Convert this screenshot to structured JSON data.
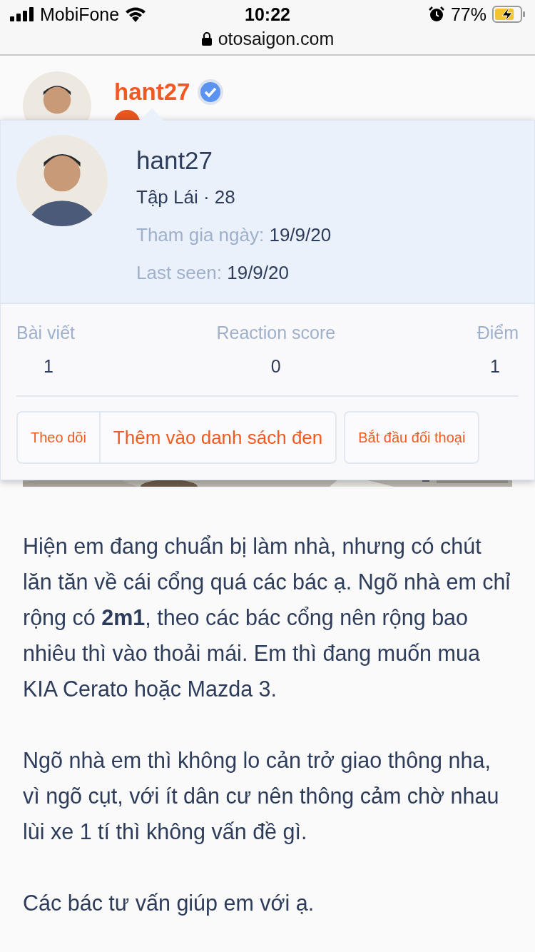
{
  "status_bar": {
    "carrier": "MobiFone",
    "time": "10:22",
    "battery": "77%",
    "charging": true,
    "alarm": true
  },
  "browser": {
    "url": "otosaigon.com",
    "secure": true
  },
  "post_author": {
    "name": "hant27",
    "verified": true
  },
  "profile_popup": {
    "name": "hant27",
    "rank": "Tập Lái · 28",
    "details": [
      {
        "label": "Tham gia ngày:",
        "value": "19/9/20"
      },
      {
        "label": "Last seen:",
        "value": "19/9/20"
      }
    ],
    "stats": [
      {
        "label": "Bài viết",
        "value": "1"
      },
      {
        "label": "Reaction score",
        "value": "0"
      },
      {
        "label": "Điểm",
        "value": "1"
      }
    ],
    "button_groups": [
      [
        {
          "label": "Theo dõi",
          "kind": "compact"
        },
        {
          "label": "Thêm vào danh sách đen",
          "kind": "wide"
        }
      ],
      [
        {
          "label": "Bắt đầu đối thoại",
          "kind": "compact"
        }
      ]
    ]
  },
  "post_body": {
    "paragraphs": [
      "Hiện em đang chuẩn bị làm nhà, nhưng có chút lăn tăn về cái cổng quá các bác ạ. Ngõ nhà em chỉ rộng có **2m1**, theo các bác cổng nên rộng bao nhiêu thì vào thoải mái. Em thì đang muốn mua KIA Cerato hoặc Mazda 3.",
      "Ngõ nhà em thì không lo cản trở giao thông nha, vì ngõ cụt, với ít dân cư nên thông cảm chờ nhau lùi xe 1 tí thì không vấn đề gì.",
      "Các bác tư vấn giúp em với ạ."
    ]
  }
}
